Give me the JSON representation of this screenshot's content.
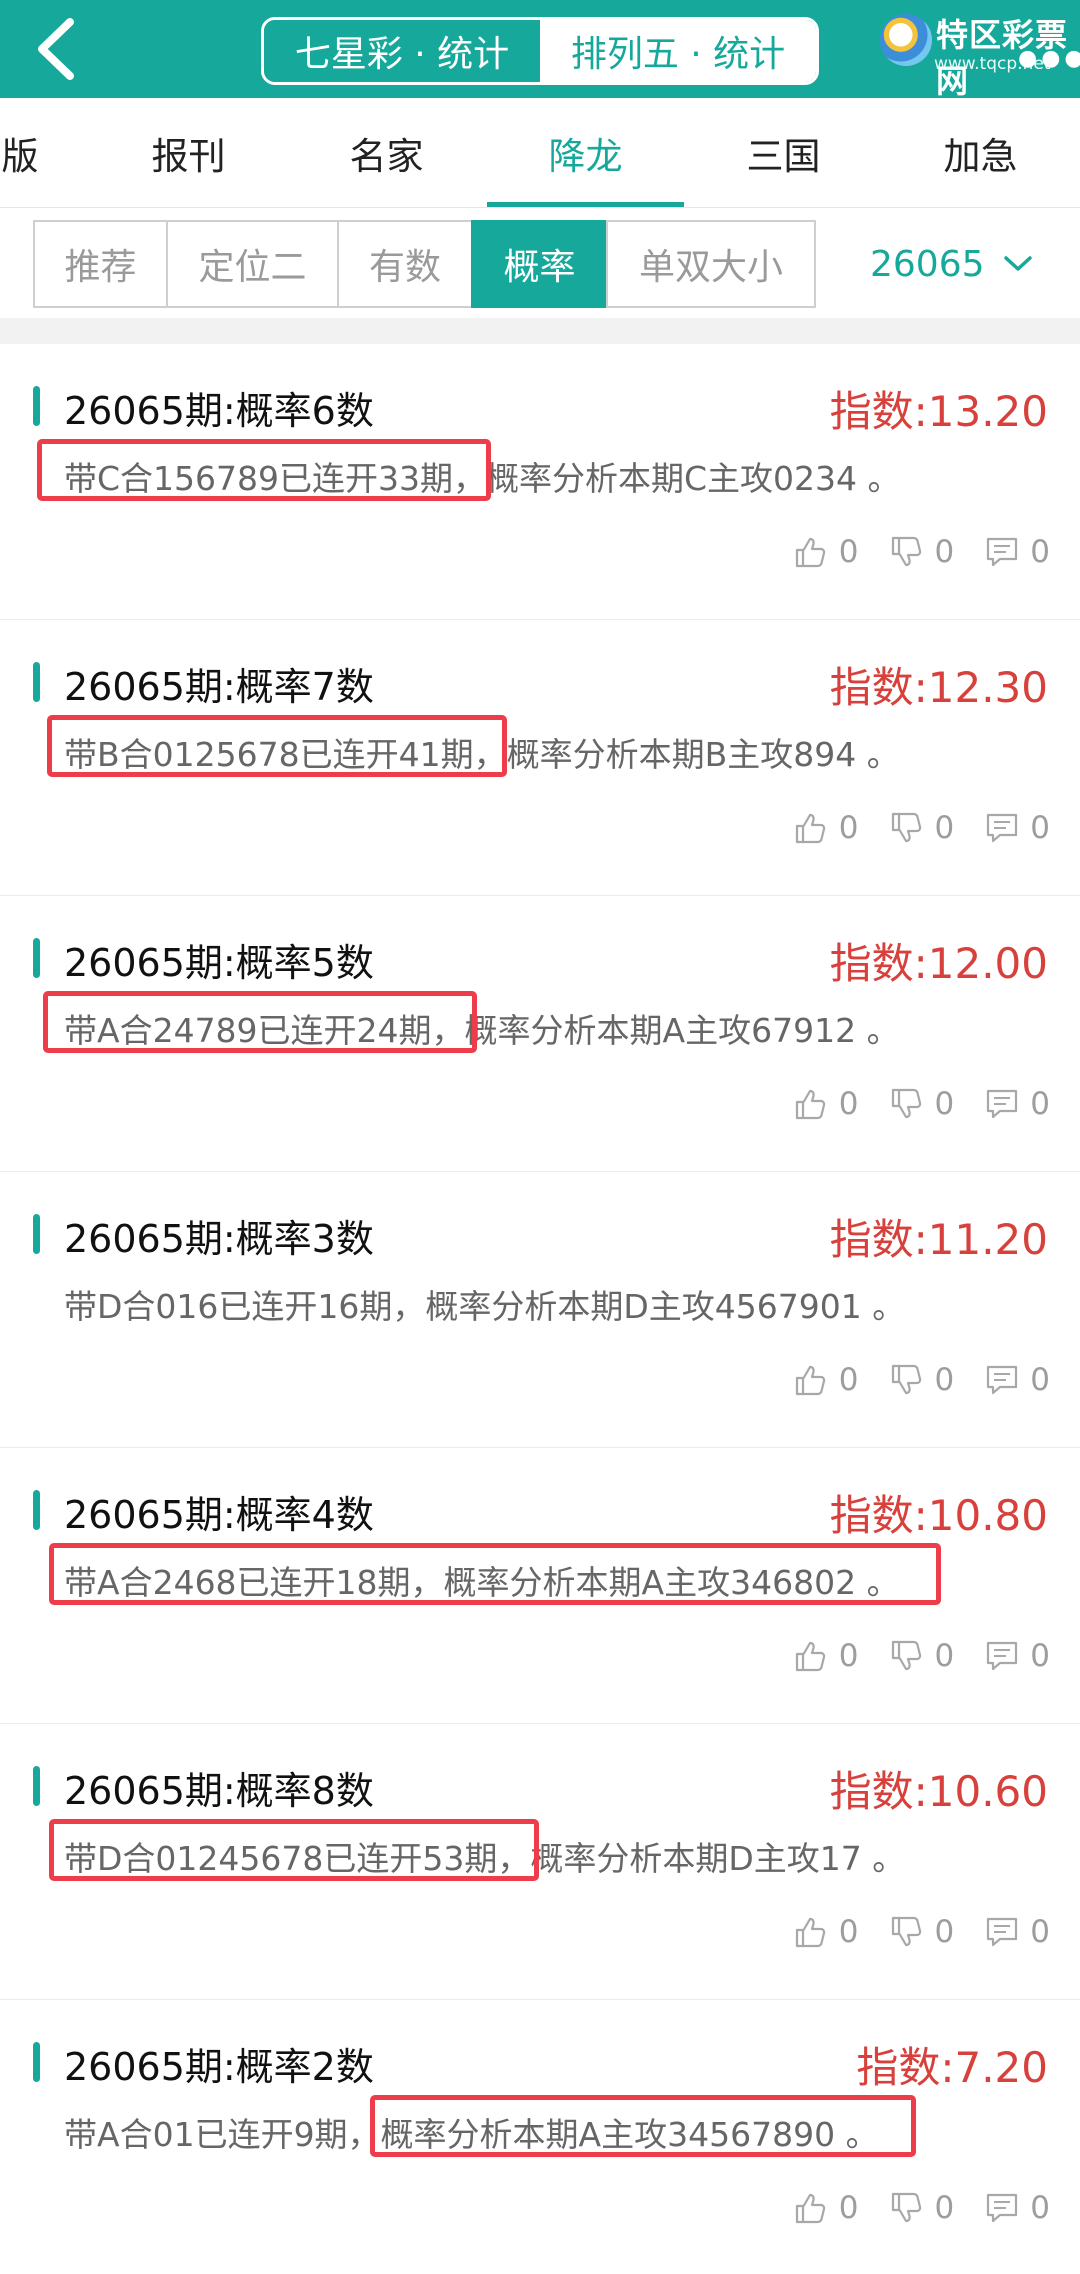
{
  "header": {
    "seg_left": "七星彩 · 统计",
    "seg_right": "排列五 · 统计",
    "logo_name": "特区彩票网",
    "logo_url": "www.tqcp.net",
    "logo_dots": "●●●"
  },
  "categories": [
    "版",
    "报刊",
    "名家",
    "降龙",
    "三国",
    "加急"
  ],
  "active_category": "降龙",
  "filters": [
    "推荐",
    "定位二",
    "有数",
    "概率",
    "单双大小"
  ],
  "active_filter": "概率",
  "issue": "26065",
  "items": [
    {
      "title": "26065期:概率6数",
      "index": "指数:13.20",
      "desc": "带C合156789已连开33期，概率分析本期C主攻0234 。",
      "like": "0",
      "dislike": "0",
      "comment": "0"
    },
    {
      "title": "26065期:概率7数",
      "index": "指数:12.30",
      "desc": "带B合0125678已连开41期，概率分析本期B主攻894 。",
      "like": "0",
      "dislike": "0",
      "comment": "0"
    },
    {
      "title": "26065期:概率5数",
      "index": "指数:12.00",
      "desc": "带A合24789已连开24期，概率分析本期A主攻67912 。",
      "like": "0",
      "dislike": "0",
      "comment": "0"
    },
    {
      "title": "26065期:概率3数",
      "index": "指数:11.20",
      "desc": "带D合016已连开16期，概率分析本期D主攻4567901 。",
      "like": "0",
      "dislike": "0",
      "comment": "0"
    },
    {
      "title": "26065期:概率4数",
      "index": "指数:10.80",
      "desc": "带A合2468已连开18期，概率分析本期A主攻346802 。",
      "like": "0",
      "dislike": "0",
      "comment": "0"
    },
    {
      "title": "26065期:概率8数",
      "index": "指数:10.60",
      "desc": "带D合01245678已连开53期，概率分析本期D主攻17 。",
      "like": "0",
      "dislike": "0",
      "comment": "0"
    },
    {
      "title": "26065期:概率2数",
      "index": "指数:7.20",
      "desc": "带A合01已连开9期，概率分析本期A主攻34567890 。",
      "like": "0",
      "dislike": "0",
      "comment": "0"
    }
  ],
  "colors": {
    "accent": "#16a99b",
    "index_red": "#d8403c",
    "highlight": "#ee3d4a"
  }
}
